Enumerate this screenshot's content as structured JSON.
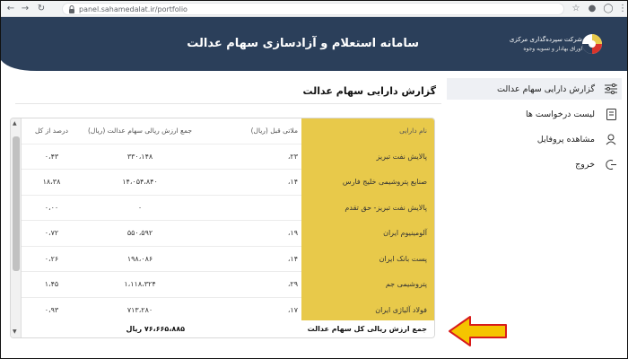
{
  "browser": {
    "url": "panel.sahamedalat.ir/portfolio"
  },
  "header": {
    "title": "سامانه استعلام و آزادسازی سهام عدالت",
    "logo_line1": "شرکت سپرده‌گذاری مرکزی",
    "logo_line2": "اوراق بهادار و تسویه وجوه"
  },
  "sidebar": {
    "items": [
      {
        "label": "گزارش دارایی سهام عدالت",
        "icon": "sliders-icon"
      },
      {
        "label": "لیست درخواست ها",
        "icon": "document-icon"
      },
      {
        "label": "مشاهده پروفایل",
        "icon": "user-icon"
      },
      {
        "label": "خروج",
        "icon": "logout-icon"
      }
    ]
  },
  "report": {
    "title": "گزارش دارایی سهام عدالت",
    "columns": [
      "نام دارایی",
      "ملاتی قبل (ریال)",
      "جمع ارزش ریالی سهام عدالت (ریال)",
      "درصد از کل"
    ],
    "rows": [
      {
        "name": "پالایش نفت تبریز",
        "par": "۲۳،",
        "total": "۳۳۰،۱۴۸",
        "pct": "۰،۴۳"
      },
      {
        "name": "صنایع پتروشیمی خلیج فارس",
        "par": "۱۴،",
        "total": "۱۴،۰۵۴،۸۴۰",
        "pct": "۱۸،۳۸"
      },
      {
        "name": "پالایش نفت تبریز- حق تقدم",
        "par": "",
        "total": "۰",
        "pct": "۰،۰۰"
      },
      {
        "name": "آلومینیوم ایران",
        "par": "۱۹،",
        "total": "۵۵۰،۵۹۲",
        "pct": "۰،۷۲"
      },
      {
        "name": "پست بانک ایران",
        "par": "۱۴،",
        "total": "۱۹۸،۰۸۶",
        "pct": "۰،۲۶"
      },
      {
        "name": "پتروشیمی جم",
        "par": "۲۹،",
        "total": "۱،۱۱۸،۳۲۴",
        "pct": "۱،۴۵"
      },
      {
        "name": "فولاد آلیاژی ایران",
        "par": "۱۷،",
        "total": "۷۱۳،۲۸۰",
        "pct": "۰،۹۳"
      }
    ],
    "sum_label": "جمع ارزش ریالی کل سهام عدالت",
    "sum_value": "۷۶،۶۶۵،۸۸۵ ریال"
  },
  "colors": {
    "header": "#2b3f5a",
    "highlight": "#e8c94a",
    "arrow": "#f5c400"
  }
}
